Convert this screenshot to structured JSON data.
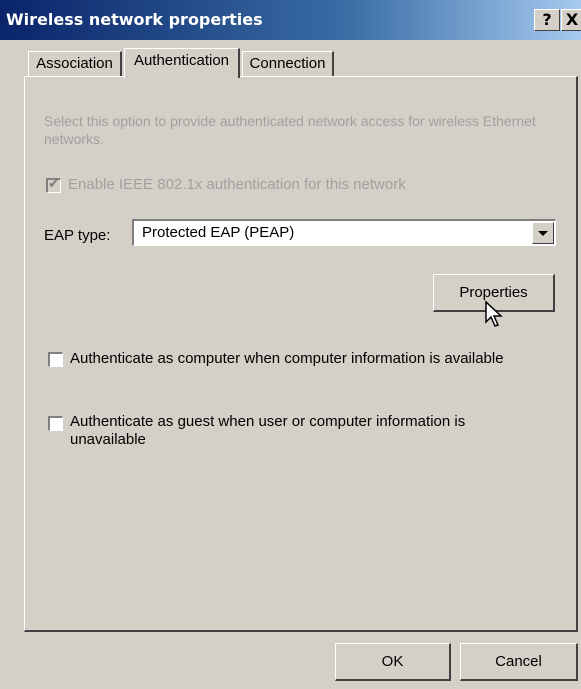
{
  "window": {
    "title": "Wireless network properties"
  },
  "titlebar": {
    "help_label": "?",
    "close_label": "X"
  },
  "tabs": [
    {
      "label": "Association",
      "active": false
    },
    {
      "label": "Authentication",
      "active": true
    },
    {
      "label": "Connection",
      "active": false
    }
  ],
  "auth": {
    "description": "Select this option to provide authenticated network access for wireless Ethernet networks.",
    "enable_8021x": {
      "label": "Enable IEEE 802.1x authentication for this network",
      "checked": true,
      "disabled": true
    },
    "eap_type": {
      "label": "EAP type:",
      "value": "Protected EAP (PEAP)"
    },
    "properties_label": "Properties",
    "auth_computer": {
      "label": "Authenticate as computer when computer information is available",
      "checked": false
    },
    "auth_guest": {
      "label": "Authenticate as guest when user or computer information is unavailable",
      "checked": false
    }
  },
  "footer": {
    "ok_label": "OK",
    "cancel_label": "Cancel"
  }
}
